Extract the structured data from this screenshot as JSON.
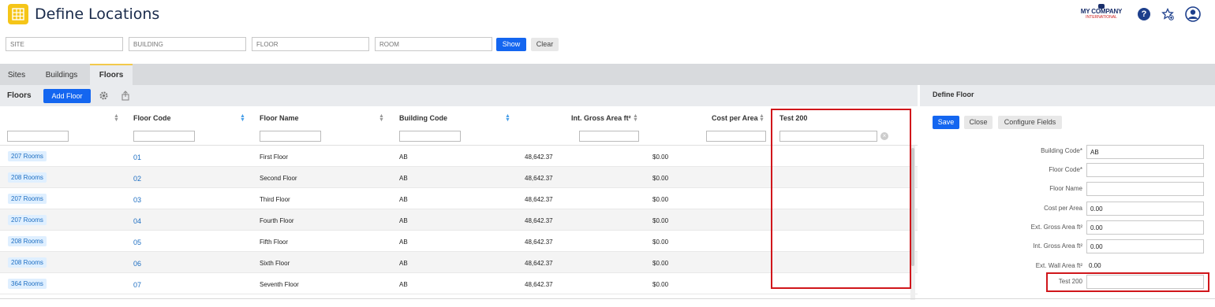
{
  "header": {
    "title": "Define Locations",
    "company_line1": "MY COMPANY",
    "company_line2": "INTERNATIONAL",
    "help_symbol": "?"
  },
  "filters": {
    "site_placeholder": "SITE",
    "building_placeholder": "BUILDING",
    "floor_placeholder": "FLOOR",
    "room_placeholder": "ROOM",
    "show_label": "Show",
    "clear_label": "Clear"
  },
  "tabs": [
    {
      "label": "Sites",
      "active": false
    },
    {
      "label": "Buildings",
      "active": false
    },
    {
      "label": "Floors",
      "active": true
    }
  ],
  "floors_panel": {
    "title": "Floors",
    "add_label": "Add Floor",
    "columns": [
      "Floor Code",
      "Floor Name",
      "Building Code",
      "Int. Gross Area ft²",
      "Cost per Area",
      "Test 200"
    ],
    "rows": [
      {
        "rooms": "207 Rooms",
        "code": "01",
        "name": "First Floor",
        "building": "AB",
        "area": "48,642.37",
        "cost": "$0.00"
      },
      {
        "rooms": "208 Rooms",
        "code": "02",
        "name": "Second Floor",
        "building": "AB",
        "area": "48,642.37",
        "cost": "$0.00"
      },
      {
        "rooms": "207 Rooms",
        "code": "03",
        "name": "Third Floor",
        "building": "AB",
        "area": "48,642.37",
        "cost": "$0.00"
      },
      {
        "rooms": "207 Rooms",
        "code": "04",
        "name": "Fourth Floor",
        "building": "AB",
        "area": "48,642.37",
        "cost": "$0.00"
      },
      {
        "rooms": "208 Rooms",
        "code": "05",
        "name": "Fifth Floor",
        "building": "AB",
        "area": "48,642.37",
        "cost": "$0.00"
      },
      {
        "rooms": "208 Rooms",
        "code": "06",
        "name": "Sixth Floor",
        "building": "AB",
        "area": "48,642.37",
        "cost": "$0.00"
      },
      {
        "rooms": "364 Rooms",
        "code": "07",
        "name": "Seventh Floor",
        "building": "AB",
        "area": "48,642.37",
        "cost": "$0.00"
      }
    ]
  },
  "define_floor": {
    "title": "Define Floor",
    "save_label": "Save",
    "close_label": "Close",
    "configure_label": "Configure Fields",
    "fields": [
      {
        "label": "Building Code*",
        "value": "AB",
        "kind": "input"
      },
      {
        "label": "Floor Code*",
        "value": "",
        "kind": "input"
      },
      {
        "label": "Floor Name",
        "value": "",
        "kind": "input"
      },
      {
        "label": "Cost per Area",
        "value": "0.00",
        "kind": "input"
      },
      {
        "label": "Ext. Gross Area ft²",
        "value": "0.00",
        "kind": "input"
      },
      {
        "label": "Int. Gross Area ft²",
        "value": "0.00",
        "kind": "input"
      },
      {
        "label": "Ext. Wall Area ft²",
        "value": "0.00",
        "kind": "static"
      },
      {
        "label": "Test 200",
        "value": "",
        "kind": "input"
      }
    ]
  },
  "colors": {
    "accent": "#1466f0",
    "highlight": "#d0161b",
    "app_icon": "#f5c518"
  },
  "icons": [
    "app-grid-icon",
    "help-icon",
    "favorites-icon",
    "user-icon",
    "settings-gear-icon",
    "export-icon",
    "sort-icon",
    "clear-filter-icon"
  ]
}
